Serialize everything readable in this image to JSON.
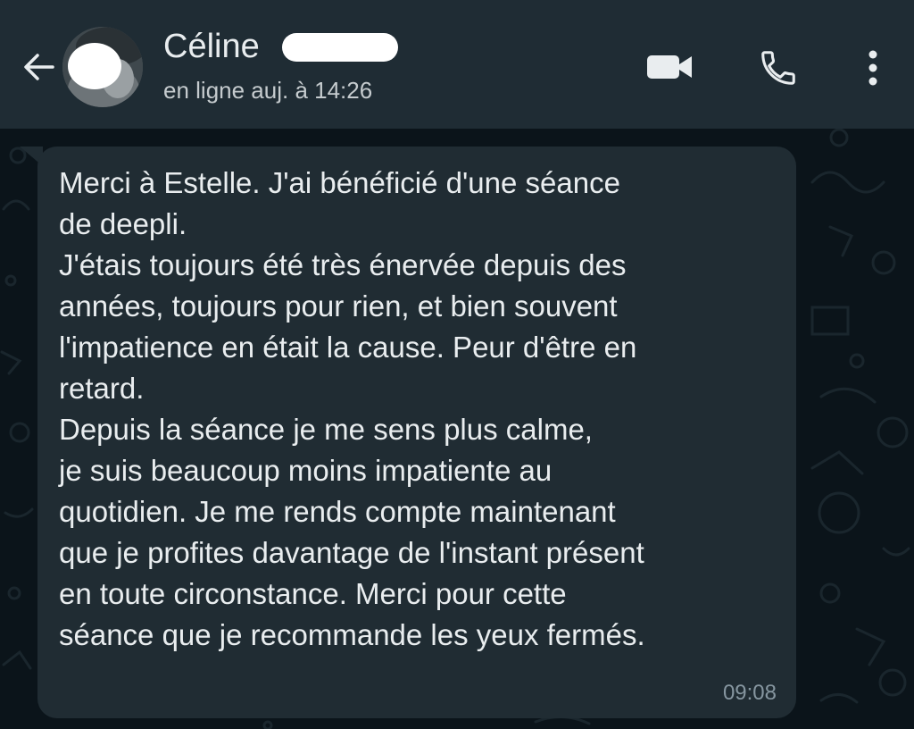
{
  "header": {
    "contact_name": "Céline",
    "status": "en ligne auj. à 14:26",
    "icons": {
      "back": "arrow-left-icon",
      "video": "video-camera-icon",
      "call": "phone-icon",
      "menu": "more-vertical-icon"
    }
  },
  "message": {
    "text": "Merci à Estelle. J'ai bénéficié d'une séance\nde deepli.\nJ'étais toujours été très énervée depuis des\nannées, toujours pour rien, et bien souvent\nl'impatience en était la cause. Peur d'être en\nretard.\nDepuis la séance je me sens plus calme,\nje suis beaucoup moins impatiente au\nquotidien. Je me rends compte maintenant\nque je profites davantage de l'instant présent\nen toute circonstance. Merci pour cette\nséance que je recommande les yeux fermés.",
    "time": "09:08"
  },
  "colors": {
    "header_bg": "#1f2c34",
    "chat_bg": "#0b141a",
    "bubble_bg": "#202c33",
    "text": "#e9edef",
    "muted": "#8696a0"
  }
}
